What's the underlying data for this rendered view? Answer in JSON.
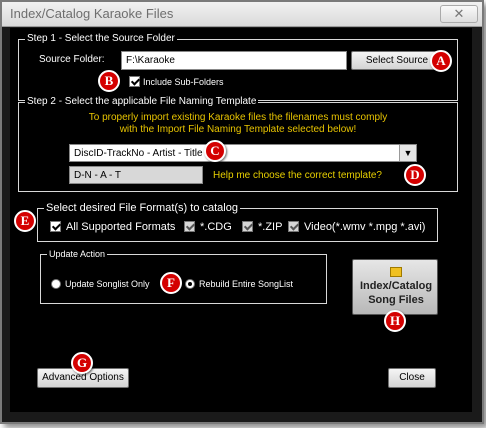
{
  "window": {
    "title": "Index/Catalog Karaoke Files",
    "close_glyph": "✕"
  },
  "step1": {
    "legend": "Step 1 - Select the Source Folder",
    "source_label": "Source Folder:",
    "source_value": "F:\\Karaoke",
    "select_button": "Select Source Folder",
    "include_sub_label": "Include Sub-Folders"
  },
  "step2": {
    "legend": "Step 2 - Select the applicable File Naming Template",
    "instruction_line1": "To properly import existing Karaoke files the filenames must comply",
    "instruction_line2": "with the Import File Naming Template selected below!",
    "template_value": "DiscID-TrackNo - Artist - Title",
    "template_code": "D-N - A - T",
    "help_link": "Help me choose the correct template?"
  },
  "formats": {
    "legend": "Select desired File Format(s) to catalog",
    "all": "All Supported Formats",
    "cdg": "*.CDG",
    "zip": "*.ZIP",
    "video": "Video(*.wmv *.mpg *.avi)"
  },
  "update": {
    "legend": "Update Action",
    "option1": "Update Songlist Only",
    "option2": "Rebuild Entire SongList"
  },
  "index_button": {
    "line1": "Index/Catalog",
    "line2": "Song Files"
  },
  "advanced_button": "Advanced Options",
  "close_button": "Close",
  "callouts": {
    "a": "A",
    "b": "B",
    "c": "C",
    "d": "D",
    "e": "E",
    "f": "F",
    "g": "G",
    "h": "H"
  },
  "colors": {
    "instruction": "#e8c400",
    "help": "#e8d000",
    "callout": "#d40000"
  },
  "icons": {
    "dropdown": "▼"
  }
}
